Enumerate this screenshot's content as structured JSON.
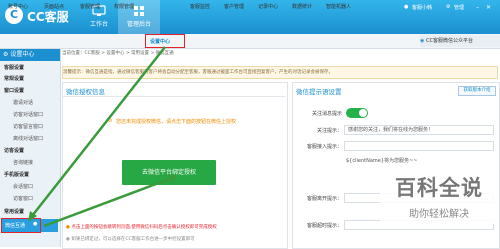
{
  "header": {
    "logo_icon": "C",
    "logo_text": "CC客服",
    "nav": [
      {
        "label": "工作台",
        "icon": "monitor-icon"
      },
      {
        "label": "管理后台",
        "icon": "grid-icon"
      }
    ],
    "user": "客服小韩",
    "menu": "管理",
    "colors": {
      "bar": "#1b8fd0",
      "accent_red": "#e3232c",
      "green": "#28a745"
    }
  },
  "tabs": {
    "items": [
      "账号中心",
      "页面站点",
      "客服管理",
      "权限管理",
      "设置中心",
      "客服监控",
      "客户管理",
      "记录中心",
      "数据统计",
      "智能机器人"
    ],
    "active_index": 4,
    "right_label": "CC客服微信公众平台"
  },
  "sidebar": {
    "title": "设置中心",
    "groups": [
      {
        "label": "客服设置",
        "items": []
      },
      {
        "label": "常规设置",
        "items": []
      },
      {
        "label": "窗口设置",
        "items": [
          "邀请对话",
          "访客对话窗口",
          "访客留言窗口",
          "离线对话窗口"
        ]
      },
      {
        "label": "访客设置",
        "items": [
          "咨询链接"
        ]
      },
      {
        "label": "手机版设置",
        "items": [
          "会话窗口",
          "访客窗口"
        ]
      },
      {
        "label": "常用设置",
        "items": [
          "微信互通"
        ]
      }
    ]
  },
  "breadcrumb": "当前位置：CC客服 > 设置中心 > 常用设置 > 微信互通",
  "notice": "温馨提示：微信互通是指，通过微信客服的客户将会自动分配至客服，客服通过截面工作台可直接回复客户，产生的对话记录会被保存。",
  "left_panel": {
    "title": "微信授权信息",
    "warning": "您还未完成授权微信，请点击下面的按钮在微信上授权",
    "button": "去微信平台绑定授权",
    "note1": "点击上面的按钮会跳转到页面,使用微信扫码后点击确认授权即可完成授权",
    "note2": "如果已绑定过，可以选择在CC客服工作台进一步中控设置即可"
  },
  "right_panel": {
    "title": "微信提示语设置",
    "link_button": "获取版本介绍",
    "rows": [
      {
        "label": "关注消息提示",
        "value": "",
        "type": "toggle"
      },
      {
        "label": "关注提示：",
        "value": "感谢您的关注，我们将在线为您服务！",
        "type": "field"
      },
      {
        "label": "客服接入提示：",
        "value": "",
        "type": "field"
      },
      {
        "label": "",
        "value": "${clientName}将为您服务~~",
        "type": "text"
      },
      {
        "label": "客服离开提示：",
        "value": "",
        "type": "field"
      },
      {
        "label": "客服超时提示：",
        "value": "",
        "type": "field"
      }
    ]
  },
  "watermark": {
    "big": "百科全说",
    "small": "助你轻松解决"
  }
}
